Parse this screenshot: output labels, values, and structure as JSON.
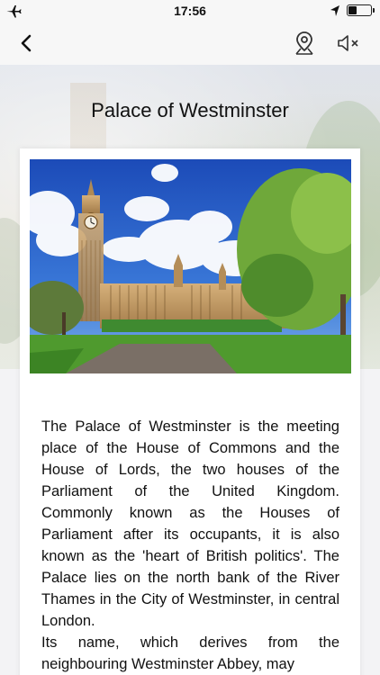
{
  "status_bar": {
    "time": "17:56"
  },
  "nav": {
    "back_icon": "chevron-left-icon",
    "map_icon": "map-pin-icon",
    "sound_icon": "speaker-muted-icon"
  },
  "page": {
    "title": "Palace of Westminster"
  },
  "article": {
    "image_subject": "Palace of Westminster with Big Ben clock tower",
    "paragraphs": [
      "The Palace of Westminster is the meeting place of the House of Commons and the House of Lords, the two houses of the Parliament of the United Kingdom. Commonly known as the Houses of Parliament after its occupants, it is also known as the 'heart of British politics'. The Palace lies on the north bank of the River Thames in the City of Westminster, in central London.",
      "Its name, which derives from the neighbouring Westminster Abbey, may"
    ]
  }
}
